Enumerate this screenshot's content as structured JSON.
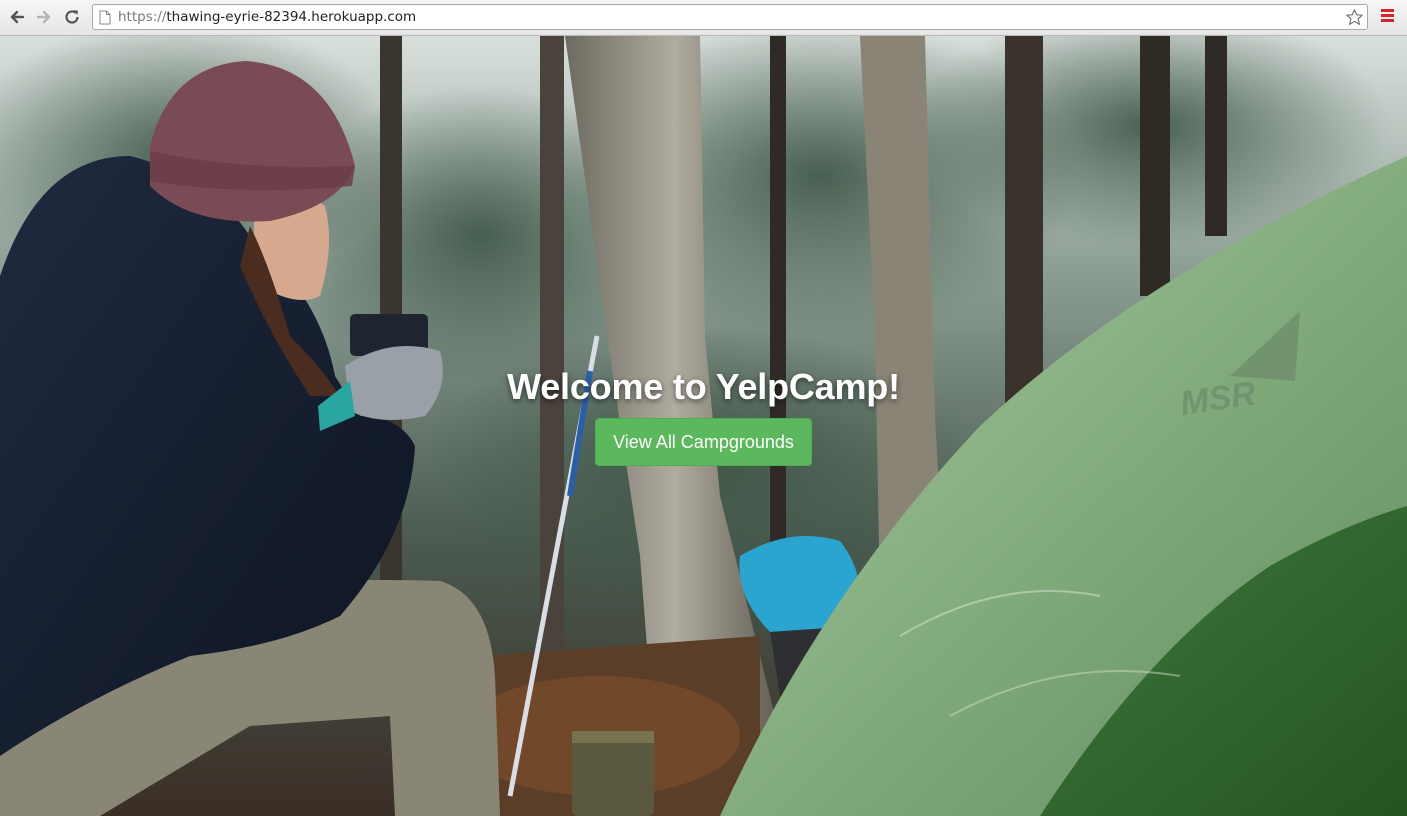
{
  "browser": {
    "url_scheme": "https://",
    "url_host": "thawing-eyrie-82394.herokuapp.com",
    "icons": [
      "back-arrow-icon",
      "forward-arrow-icon",
      "reload-icon",
      "page-icon",
      "star-icon",
      "menu-icon"
    ],
    "menu_color": "#d6262a"
  },
  "landing": {
    "title": "Welcome to YelpCamp!",
    "button_label": "View All Campgrounds",
    "button_color": "#5cb85c"
  },
  "background": {
    "description_icon": "camping-photo"
  }
}
